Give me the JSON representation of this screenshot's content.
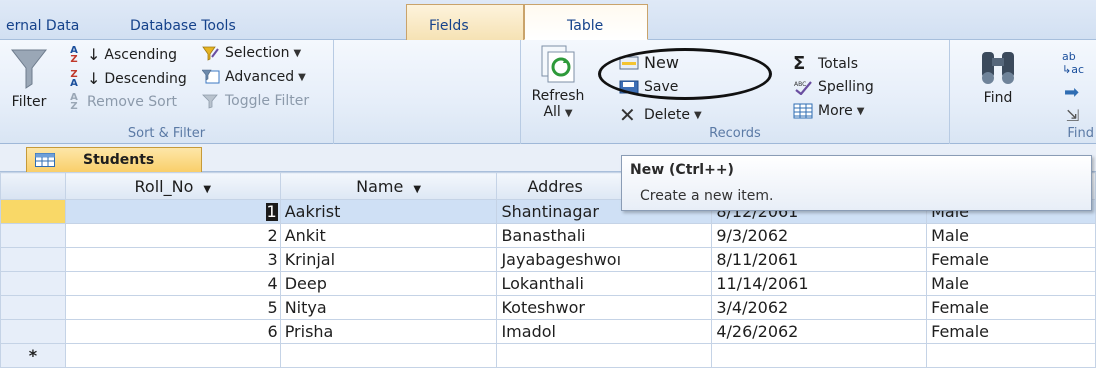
{
  "ribbon_tabs": [
    "ernal Data",
    "Database Tools",
    "Fields",
    "Table"
  ],
  "sort_filter": {
    "filter_label": "Filter",
    "ascending": "Ascending",
    "descending": "Descending",
    "remove_sort": "Remove Sort",
    "selection": "Selection",
    "advanced": "Advanced",
    "toggle_filter": "Toggle Filter",
    "group_label": "Sort & Filter"
  },
  "records": {
    "refresh_line1": "Refresh",
    "refresh_line2": "All",
    "new": "New",
    "save": "Save",
    "delete": "Delete",
    "totals": "Totals",
    "spelling": "Spelling",
    "more": "More",
    "group_label": "Records"
  },
  "find": {
    "find_label": "Find",
    "group_label": "Find"
  },
  "tooltip": {
    "title": "New (Ctrl++)",
    "body": "Create a new item."
  },
  "object_tab": "Students",
  "table": {
    "columns": [
      "Roll_No",
      "Name",
      "Addres"
    ],
    "rows": [
      {
        "roll": "1",
        "name": "Aakrist",
        "address": "Shantinagar",
        "dob": "8/12/2061",
        "gender": "Male"
      },
      {
        "roll": "2",
        "name": "Ankit",
        "address": "Banasthali",
        "dob": "9/3/2062",
        "gender": "Male"
      },
      {
        "roll": "3",
        "name": "Krinjal",
        "address": "Jayabageshwoı",
        "dob": "8/11/2061",
        "gender": "Female"
      },
      {
        "roll": "4",
        "name": "Deep",
        "address": "Lokanthali",
        "dob": "11/14/2061",
        "gender": "Male"
      },
      {
        "roll": "5",
        "name": "Nitya",
        "address": "Koteshwor",
        "dob": "3/4/2062",
        "gender": "Female"
      },
      {
        "roll": "6",
        "name": "Prisha",
        "address": "Imadol",
        "dob": "4/26/2062",
        "gender": "Female"
      }
    ],
    "new_row_marker": "*"
  },
  "colors": {
    "accent_blue": "#15428b",
    "current_row": "#cfe0f5",
    "object_tab": "#f9cf6a"
  }
}
